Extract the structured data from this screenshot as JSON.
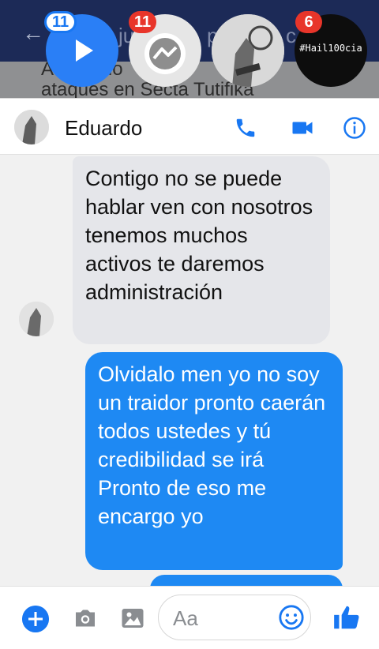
{
  "background_app": {
    "back_arrow": "←",
    "title_fragment_1": "ju",
    "title_fragment_2": "p",
    "title_fragment_3": "c",
    "line_1": "A    str         P      do",
    "line_2": "ataques en Secta  Tutifika"
  },
  "chat_heads": [
    {
      "badge": "11",
      "icon": "play-icon"
    },
    {
      "badge": "11",
      "icon": "messenger-icon"
    },
    {
      "badge": "",
      "icon": "profile-photo"
    },
    {
      "badge": "6",
      "icon": "hashtag-avatar",
      "label": "#Hail100cia"
    }
  ],
  "header": {
    "name": "Eduardo",
    "icons": [
      "phone-icon",
      "video-camera-icon",
      "info-icon"
    ],
    "accent": "#1877f2"
  },
  "messages": [
    {
      "direction": "incoming",
      "text": "Contigo no se puede hablar ven con nosotros tenemos muchos activos te daremos administración"
    },
    {
      "direction": "outgoing",
      "text": "Olvidalo men yo no soy un traidor pronto caerán todos ustedes y tú credibilidad se irá Pronto de eso me encargo yo"
    }
  ],
  "composer": {
    "placeholder": "Aa",
    "icons": [
      "plus-icon",
      "camera-icon",
      "gallery-icon",
      "emoji-icon",
      "like-icon"
    ]
  },
  "colors": {
    "outgoing_bubble": "#1e89f3",
    "incoming_bubble": "#e5e6ea",
    "badge_red": "#e8352a",
    "top_bar": "#1c2a57"
  }
}
